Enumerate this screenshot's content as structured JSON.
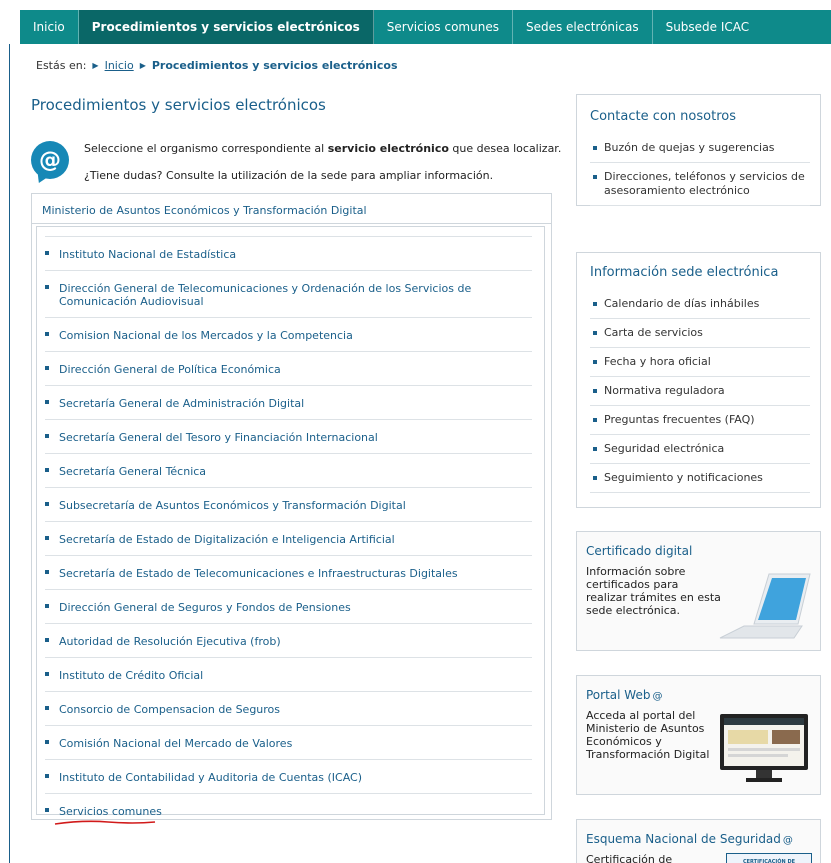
{
  "topnav": {
    "items": [
      {
        "label": "Inicio",
        "active": false
      },
      {
        "label": "Procedimientos y servicios electrónicos",
        "active": true
      },
      {
        "label": "Servicios comunes",
        "active": false
      },
      {
        "label": "Sedes electrónicas",
        "active": false
      },
      {
        "label": "Subsede ICAC",
        "active": false
      }
    ]
  },
  "breadcrumb": {
    "prefix": "Estás en:",
    "home": "Inicio",
    "current": "Procedimientos y servicios electrónicos"
  },
  "main": {
    "title": "Procedimientos y servicios electrónicos",
    "intro_before": "Seleccione el organismo correspondiente al ",
    "intro_bold": "servicio electrónico",
    "intro_after": " que desea localizar.",
    "intro_help": "¿Tiene dudas? Consulte la utilización de la sede para ampliar información.",
    "ministry": "Ministerio de Asuntos Económicos y Transformación Digital",
    "organisms": [
      "Instituto Nacional de Estadística",
      "Dirección General de Telecomunicaciones y Ordenación de los Servicios de Comunicación Audiovisual",
      "Comision Nacional de los Mercados y la Competencia",
      "Dirección General de Política Económica",
      "Secretaría General de Administración Digital",
      "Secretaría General del Tesoro y Financiación Internacional",
      "Secretaría General Técnica",
      "Subsecretaría de Asuntos Económicos y Transformación Digital",
      "Secretaría de Estado de Digitalización e Inteligencia Artificial",
      "Secretaría de Estado de Telecomunicaciones e Infraestructuras Digitales",
      "Dirección General de Seguros y Fondos de Pensiones",
      "Autoridad de Resolución Ejecutiva (frob)",
      "Instituto de Crédito Oficial",
      "Consorcio de Compensacion de Seguros",
      "Comisión Nacional del Mercado de Valores",
      "Instituto de Contabilidad y Auditoria de Cuentas (ICAC)",
      "Servicios comunes"
    ]
  },
  "sidebar": {
    "contact": {
      "title": "Contacte con nosotros",
      "items": [
        "Buzón de quejas y sugerencias",
        "Direcciones, teléfonos y servicios de asesoramiento electrónico"
      ]
    },
    "info": {
      "title": "Información sede electrónica",
      "items": [
        "Calendario de días inhábiles",
        "Carta de servicios",
        "Fecha y hora oficial",
        "Normativa reguladora",
        "Preguntas frecuentes (FAQ)",
        "Seguridad electrónica",
        "Seguimiento y notificaciones"
      ]
    },
    "cert": {
      "title": "Certificado digital",
      "text": "Información sobre certificados para realizar trámites en esta sede electrónica."
    },
    "portal": {
      "title": "Portal Web",
      "text": "Acceda al portal del Ministerio de Asuntos Económicos y Transformación Digital"
    },
    "ens": {
      "title": "Esquema Nacional de Seguridad",
      "text": "Certificación de",
      "badge": "CERTIFICACIÓN DE"
    }
  },
  "colors": {
    "nav_bg": "#0e8a8a",
    "nav_active": "#0a6767",
    "link": "#1a5f8a",
    "icon_bg": "#1788b6",
    "annotation": "#d11a1a"
  }
}
